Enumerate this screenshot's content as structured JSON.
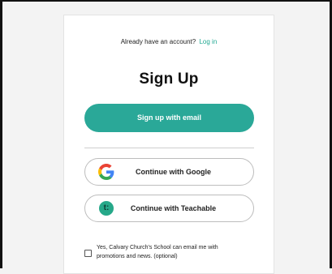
{
  "login_prompt": {
    "text": "Already have an account?",
    "link": "Log in"
  },
  "title": "Sign Up",
  "buttons": {
    "email": "Sign up with email",
    "google": "Continue with Google",
    "teachable": "Continue with Teachable"
  },
  "icons": {
    "google": "google-icon",
    "teachable": "teachable-icon",
    "teachable_glyph": "t:"
  },
  "consent": {
    "line1": "Yes, Calvary Church's School can email me with",
    "line2": "promotions and news. (optional)",
    "checked": false
  },
  "colors": {
    "accent": "#2aa898",
    "link": "#20a892",
    "teachable": "#26a889"
  }
}
